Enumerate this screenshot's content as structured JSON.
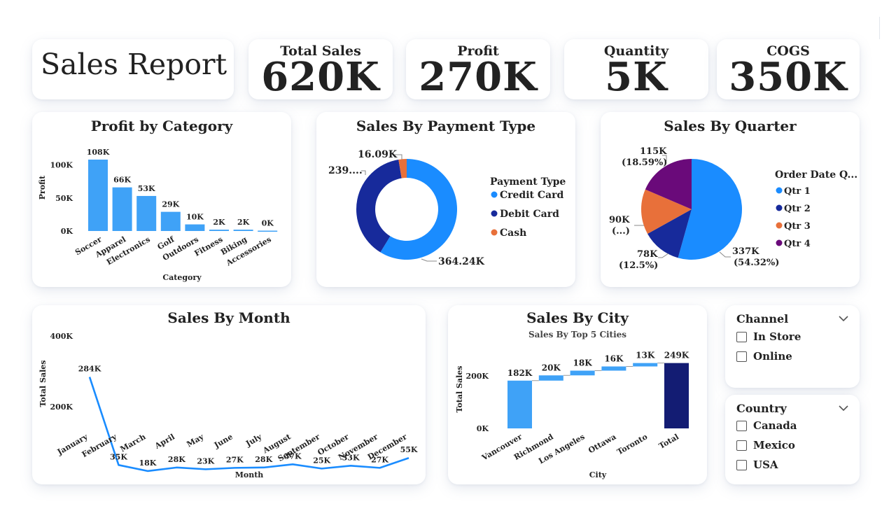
{
  "report_title": "Sales Report",
  "kpis": [
    {
      "label": "Total Sales",
      "value": "620K"
    },
    {
      "label": "Profit",
      "value": "270K"
    },
    {
      "label": "Quantity",
      "value": "5K"
    },
    {
      "label": "COGS",
      "value": "350K"
    }
  ],
  "colors": {
    "bar": "#3fa2f7",
    "credit": "#1a8cff",
    "debit": "#172a9b",
    "cash": "#e8703a",
    "qtr1": "#1a8cff",
    "qtr2": "#172a9b",
    "qtr3": "#e8703a",
    "qtr4": "#6a0a7a",
    "total": "#131c73"
  },
  "chart_data": [
    {
      "id": "profit_by_category",
      "type": "bar",
      "title": "Profit by Category",
      "xlabel": "Category",
      "ylabel": "Profit",
      "categories": [
        "Soccer",
        "Apparel",
        "Electronics",
        "Golf",
        "Outdoors",
        "Fitness",
        "Biking",
        "Accessories"
      ],
      "values": [
        108,
        66,
        53,
        29,
        10,
        2,
        2,
        0.5
      ],
      "data_labels": [
        "108K",
        "66K",
        "53K",
        "29K",
        "10K",
        "2K",
        "2K",
        "0K"
      ],
      "yticks": [
        0,
        50,
        100
      ],
      "ytick_labels": [
        "0K",
        "50K",
        "100K"
      ],
      "ylim": [
        0,
        108
      ]
    },
    {
      "id": "sales_by_payment",
      "type": "pie",
      "donut": true,
      "title": "Sales By Payment Type",
      "legend_title": "Payment Type",
      "legend_position": "right",
      "labels": [
        "Credit Card",
        "Debit Card",
        "Cash"
      ],
      "values": [
        364.24,
        239.67,
        16.09
      ],
      "data_labels": [
        "364.24K",
        "239....",
        "16.09K"
      ]
    },
    {
      "id": "sales_by_quarter",
      "type": "pie",
      "donut": false,
      "title": "Sales By Quarter",
      "legend_title": "Order Date Q...",
      "legend_position": "right",
      "labels": [
        "Qtr 1",
        "Qtr 2",
        "Qtr 3",
        "Qtr 4"
      ],
      "values": [
        337,
        78,
        90,
        115
      ],
      "data_labels": [
        [
          "337K",
          "(54.32%)"
        ],
        [
          "78K",
          "(12.5%)"
        ],
        [
          "90K",
          "(...)"
        ],
        [
          "115K",
          "(18.59%)"
        ]
      ]
    },
    {
      "id": "sales_by_month",
      "type": "line",
      "title": "Sales By Month",
      "xlabel": "Month",
      "ylabel": "Total Sales",
      "categories": [
        "January",
        "February",
        "March",
        "April",
        "May",
        "June",
        "July",
        "August",
        "September",
        "October",
        "November",
        "December"
      ],
      "values": [
        284,
        35,
        18,
        28,
        23,
        27,
        28,
        37,
        25,
        33,
        27,
        55
      ],
      "data_labels": [
        "284K",
        "35K",
        "18K",
        "28K",
        "23K",
        "27K",
        "28K",
        "37K",
        "25K",
        "33K",
        "27K",
        "55K"
      ],
      "ytick_labels": [
        "200K",
        "400K"
      ],
      "ylim": [
        0,
        400
      ]
    },
    {
      "id": "sales_by_city",
      "type": "bar",
      "subtype": "waterfall",
      "title": "Sales By City",
      "subtitle": "Sales By Top 5 Cities",
      "xlabel": "City",
      "ylabel": "Total Sales",
      "categories": [
        "Vancouver",
        "Richmond",
        "Los Angeles",
        "Ottawa",
        "Toronto",
        "Total"
      ],
      "values": [
        182,
        20,
        18,
        16,
        13,
        249
      ],
      "data_labels": [
        "182K",
        "20K",
        "18K",
        "16K",
        "13K",
        "249K"
      ],
      "ytick_labels": [
        "0K",
        "200K"
      ],
      "ylim": [
        0,
        260
      ]
    }
  ],
  "slicers": [
    {
      "title": "Channel",
      "options": [
        "In Store",
        "Online"
      ]
    },
    {
      "title": "Country",
      "options": [
        "Canada",
        "Mexico",
        "USA"
      ]
    }
  ]
}
